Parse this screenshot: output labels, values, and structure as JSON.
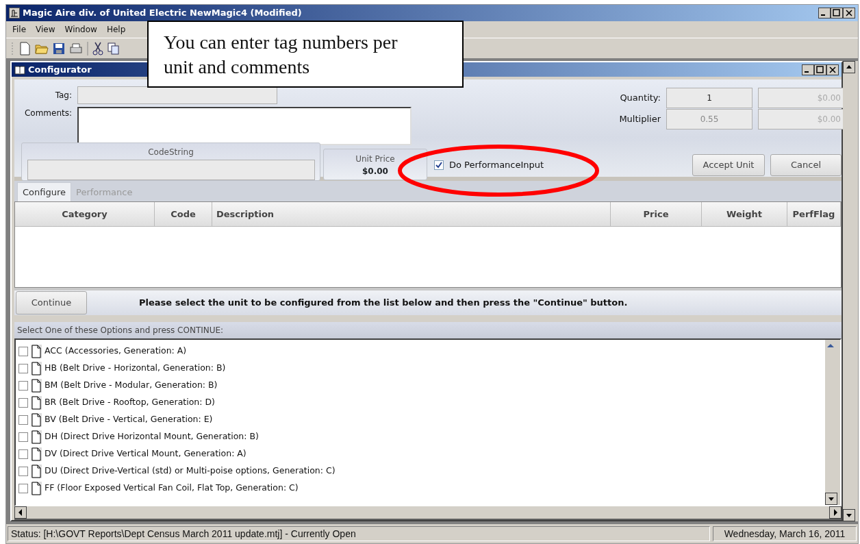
{
  "window": {
    "title": "Magic Aire div. of United Electric NewMagic4 (Modified)"
  },
  "menu": [
    "File",
    "View",
    "Window",
    "Help"
  ],
  "callout": {
    "text": "You can enter tag numbers per unit and comments"
  },
  "configurator": {
    "title": "Configurator",
    "tag_label": "Tag:",
    "comments_label": "Comments:",
    "quantity": {
      "label": "Quantity:",
      "value": "1",
      "total": "$0.00"
    },
    "multiplier": {
      "label": "Multiplier",
      "value": "0.55",
      "total": "$0.00"
    },
    "codestring": {
      "label": "CodeString"
    },
    "unit_price": {
      "label": "Unit Price",
      "value": "$0.00"
    },
    "performance_input": {
      "label": "Do PerformanceInput",
      "checked": true
    },
    "buttons": [
      "Accept Unit",
      "Cancel"
    ],
    "tabs": [
      {
        "label": "Configure",
        "selected": true
      },
      {
        "label": "Performance",
        "selected": false
      }
    ],
    "table": {
      "columns": [
        "Category",
        "Code",
        "Description",
        "Price",
        "Weight",
        "PerfFlag"
      ]
    },
    "continue_button": "Continue",
    "instruction": "Please select the unit to be configured from the list below and then press the \"Continue\" button.",
    "options_header": "Select One of these Options and press CONTINUE:",
    "options": [
      {
        "label": "ACC (Accessories, Generation: A)",
        "checked": false
      },
      {
        "label": "HB (Belt Drive - Horizontal, Generation: B)",
        "checked": false
      },
      {
        "label": "BM (Belt Drive - Modular, Generation: B)",
        "checked": false
      },
      {
        "label": "BR (Belt Drive - Rooftop, Generation: D)",
        "checked": false
      },
      {
        "label": "BV (Belt Drive - Vertical, Generation: E)",
        "checked": false
      },
      {
        "label": "DH (Direct Drive Horizontal Mount, Generation: B)",
        "checked": false
      },
      {
        "label": "DV (Direct Drive Vertical Mount, Generation: A)",
        "checked": false
      },
      {
        "label": "DU (Direct Drive-Vertical (std) or Multi-poise options, Generation: C)",
        "checked": false
      },
      {
        "label": "FF (Floor Exposed Vertical Fan Coil, Flat Top, Generation: C)",
        "checked": false
      }
    ]
  },
  "status_bar": {
    "status": "Status: [H:\\GOVT Reports\\Dept Census March 2011 update.mtj] - Currently Open",
    "date": "Wednesday, March 16, 2011"
  }
}
